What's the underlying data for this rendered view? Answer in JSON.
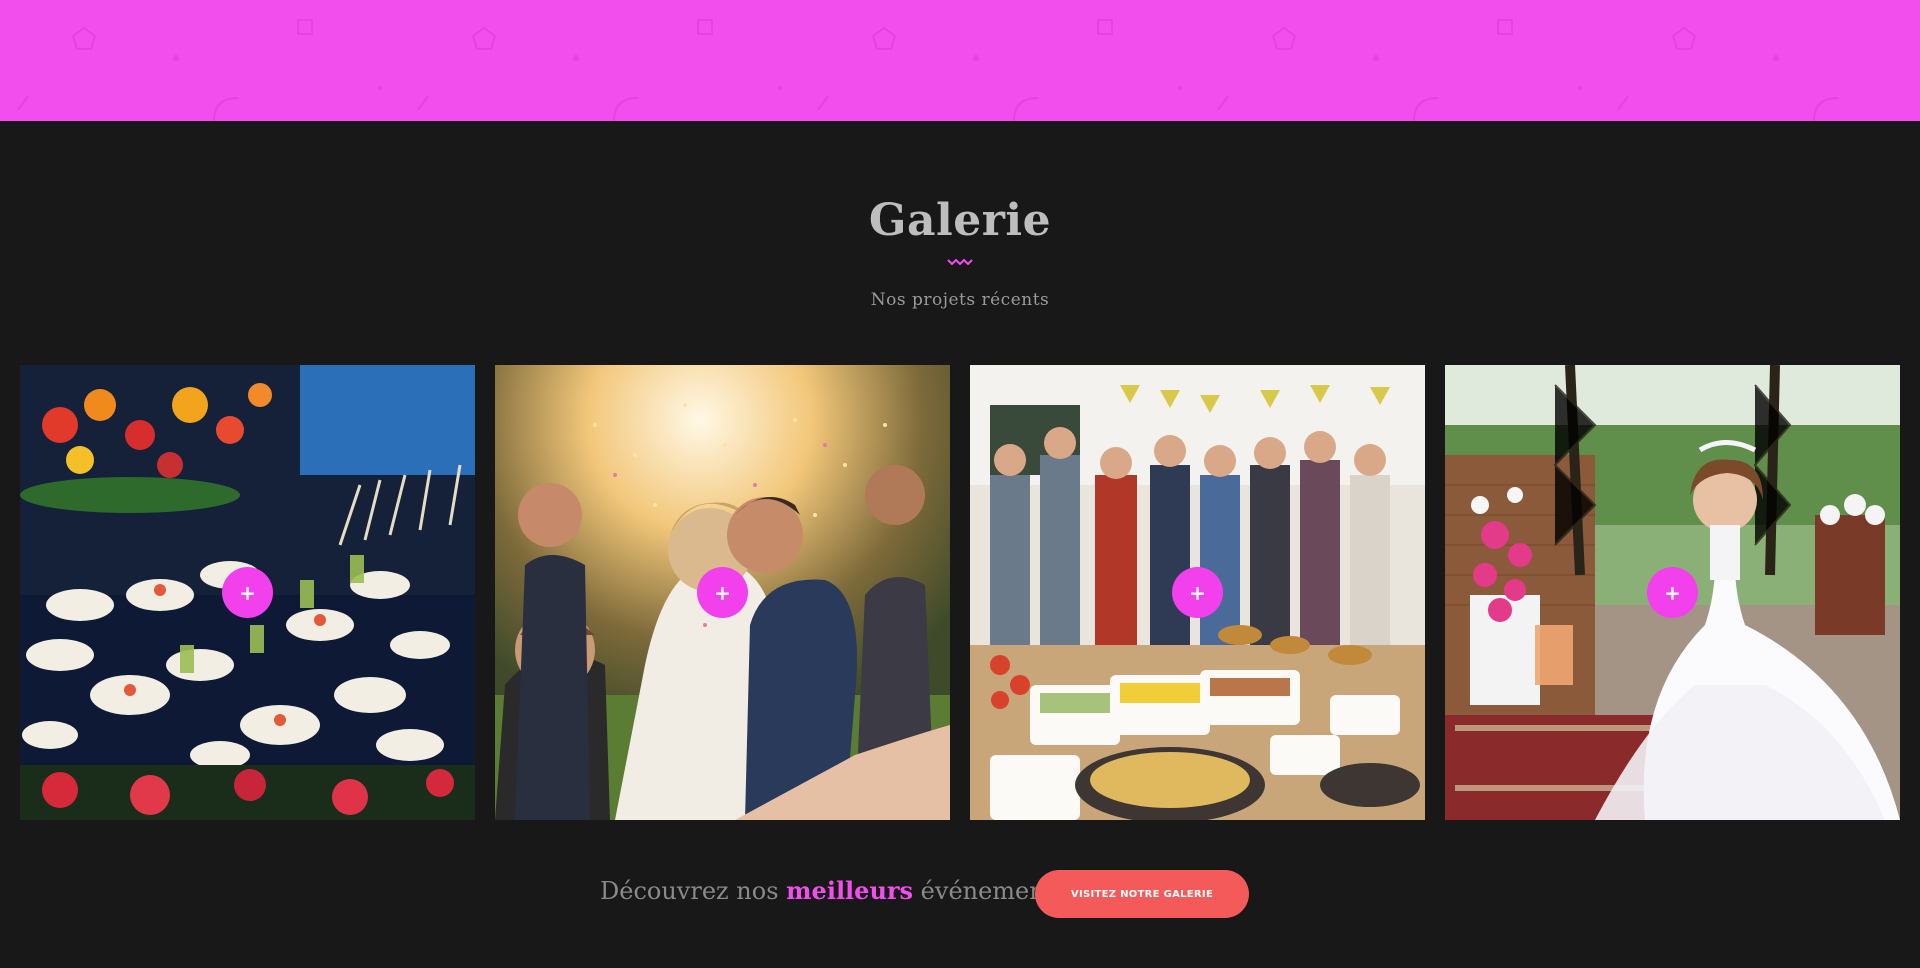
{
  "banner": {
    "background_color": "#f24ded",
    "pattern": "faint pentagons, squares, dots and arcs"
  },
  "gallery": {
    "title": "Galerie",
    "subtitle": "Nos projets récents",
    "accent_color": "#f24ded",
    "items": [
      {
        "image": "catering buffet with flowers and appetizers",
        "plus_label": "+"
      },
      {
        "image": "wedding couple kissing under confetti",
        "plus_label": "+"
      },
      {
        "image": "party guests at buffet",
        "plus_label": "+"
      },
      {
        "image": "girl in white dress in garden",
        "plus_label": "+"
      }
    ]
  },
  "cta": {
    "text_before": "Découvrez nos ",
    "highlight": "meilleurs",
    "text_after": " événements",
    "button_label": "VISITEZ NOTRE GALERIE",
    "button_color": "#f55a5a"
  }
}
